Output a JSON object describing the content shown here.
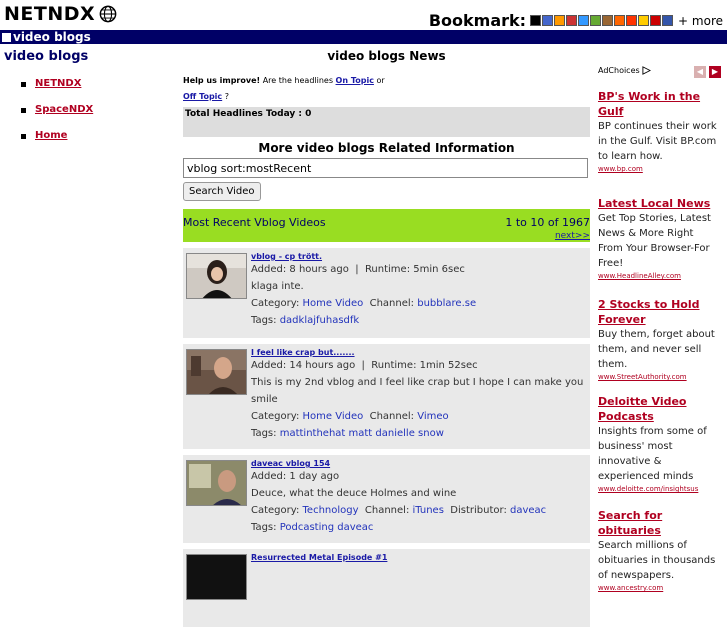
{
  "header": {
    "logo": "NETNDX",
    "bookmark_label": "Bookmark:",
    "more_label": "+ more",
    "bookmark_icons": [
      "#000000",
      "#4466cc",
      "#ff9900",
      "#cc3333",
      "#3399ff",
      "#66aa33",
      "#996633",
      "#ff6600",
      "#ff3300",
      "#ffcc00",
      "#cc0000",
      "#3355aa"
    ]
  },
  "navbar": {
    "label": "video blogs"
  },
  "sidebar": {
    "title": "video blogs",
    "items": [
      {
        "label": "NETNDX"
      },
      {
        "label": "SpaceNDX"
      },
      {
        "label": "Home"
      }
    ]
  },
  "main": {
    "title": "video blogs News",
    "help": {
      "prefix": "Help us improve!",
      "text": " Are the headlines ",
      "on_topic": "On Topic",
      "or": " or",
      "off_topic": "Off Topic",
      "suffix": " ?"
    },
    "total_headlines": "Total Headlines Today : 0",
    "related_title": "More video blogs Related Information",
    "search_value": "vblog sort:mostRecent",
    "search_button": "Search Video",
    "recent_title": "Most Recent Vblog Videos",
    "recent_count": "1 to 10 of 1967",
    "next_label": "next>>",
    "videos": [
      {
        "title": "vblog - cp trött.",
        "added": "Added: 8 hours ago",
        "runtime": "Runtime: 5min 6sec",
        "description": "klaga inte.",
        "category_label": "Category:",
        "category": "Home Video",
        "channel_label": "Channel:",
        "channel": "bubblare.se",
        "tags_label": "Tags:",
        "tags": "dadklajfuhasdfk"
      },
      {
        "title": "I feel like crap but.......",
        "added": "Added: 14 hours ago",
        "runtime": "Runtime: 1min 52sec",
        "description": "This is my 2nd vblog and I feel like crap but I hope I can make you smile",
        "category_label": "Category:",
        "category": "Home Video",
        "channel_label": "Channel:",
        "channel": "Vimeo",
        "tags_label": "Tags:",
        "tags": "mattinthehat  matt  danielle  snow"
      },
      {
        "title": "daveac vblog 154",
        "added": "Added: 1 day ago",
        "runtime": "",
        "description": "Deuce, what the deuce Holmes and wine",
        "category_label": "Category:",
        "category": "Technology",
        "channel_label": "Channel:",
        "channel": "iTunes",
        "distributor_label": "Distributor:",
        "distributor": "daveac",
        "tags_label": "Tags:",
        "tags": "Podcasting  daveac"
      },
      {
        "title": "Resurrected Metal Episode #1"
      }
    ]
  },
  "ads": {
    "adchoices": "AdChoices",
    "items": [
      {
        "title": "BP's Work in the Gulf",
        "desc": "BP continues their work in the Gulf. Visit BP.com to learn how.",
        "url": "www.bp.com"
      },
      {
        "title": "Latest Local News",
        "desc": "Get Top Stories, Latest News & More Right From Your Browser-For Free!",
        "url": "www.HeadlineAlley.com"
      },
      {
        "title": "2 Stocks to Hold Forever",
        "desc": "Buy them, forget about them, and never sell them.",
        "url": "www.StreetAuthority.com"
      },
      {
        "title": "Deloitte Video Podcasts",
        "desc": "Insights from some of business' most innovative & experienced minds",
        "url": "www.deloitte.com/insightsus"
      },
      {
        "title": "Search for obituaries",
        "desc": "Search millions of obituaries in thousands of newspapers.",
        "url": "www.ancestry.com"
      }
    ]
  }
}
